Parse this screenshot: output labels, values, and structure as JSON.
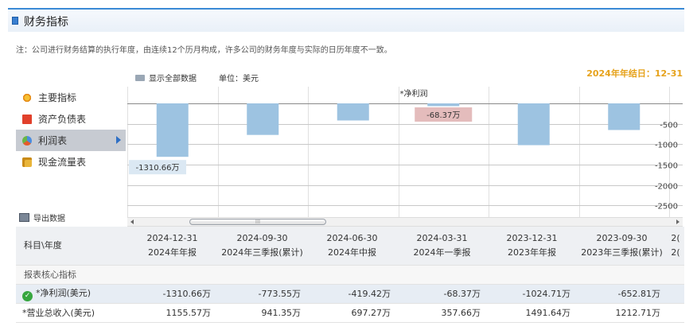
{
  "page": {
    "title": "财务指标",
    "note": "注：公司进行财务结算的执行年度，由连续12个历月构成，许多公司的财务年度与实际的日历年度不一致。",
    "show_all_label": "显示全部数据",
    "unit_label": "单位：美元",
    "fiscal_year_end": "2024年年结日：12-31",
    "export_label": "导出数据",
    "scroll_thumb_label": "III"
  },
  "menu": {
    "items": [
      {
        "label": "主要指标",
        "icon": "pie-chart-icon",
        "active": false
      },
      {
        "label": "资产负债表",
        "icon": "document-icon",
        "active": false
      },
      {
        "label": "利润表",
        "icon": "ball-icon",
        "active": true
      },
      {
        "label": "现金流量表",
        "icon": "coins-icon",
        "active": false
      }
    ]
  },
  "colors": {
    "bar": "#9dc3e1",
    "highlight_bar": "#e4bcbc",
    "accent": "#e6a21b",
    "title_border": "#3a8ad6"
  },
  "chart_data": {
    "type": "bar",
    "title": "*净利润",
    "categories": [
      "2024-12-31",
      "2024-09-30",
      "2024-06-30",
      "2024-03-31",
      "2023-12-31",
      "2023-09-30"
    ],
    "values": [
      -1310.66,
      -773.55,
      -419.42,
      -68.37,
      -1024.71,
      -652.81
    ],
    "ylim": [
      -2750,
      0
    ],
    "yticks": [
      -500,
      -1000,
      -1500,
      -2000,
      -2500
    ],
    "tick_labels": [
      "-500",
      "-1000",
      "-1500",
      "-2000",
      "-2500"
    ],
    "data_labels": [
      {
        "index": 0,
        "text": "-1310.66万"
      },
      {
        "index": 3,
        "text": "-68.37万"
      }
    ],
    "highlight_index": 3,
    "grid": true
  },
  "table": {
    "header_first": "科目\\年度",
    "columns": [
      {
        "date": "2024-12-31",
        "period": "2024年年报"
      },
      {
        "date": "2024-09-30",
        "period": "2024年三季报(累计)"
      },
      {
        "date": "2024-06-30",
        "period": "2024年中报"
      },
      {
        "date": "2024-03-31",
        "period": "2024年一季报"
      },
      {
        "date": "2023-12-31",
        "period": "2023年年报"
      },
      {
        "date": "2023-09-30",
        "period": "2023年三季报(累计)"
      },
      {
        "date": "2(",
        "period": "2("
      }
    ],
    "section_label": "报表核心指标",
    "rows": [
      {
        "label": "*净利润(美元)",
        "values": [
          "-1310.66万",
          "-773.55万",
          "-419.42万",
          "-68.37万",
          "-1024.71万",
          "-652.81万",
          ""
        ]
      },
      {
        "label": "*营业总收入(美元)",
        "values": [
          "1155.57万",
          "941.35万",
          "697.27万",
          "357.66万",
          "1491.64万",
          "1212.71万",
          ""
        ]
      }
    ]
  }
}
